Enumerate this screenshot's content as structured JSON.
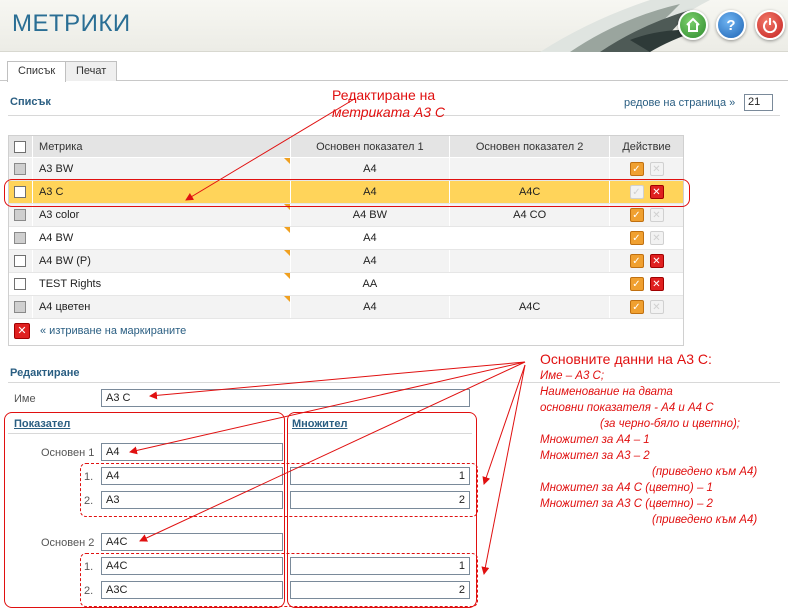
{
  "app": {
    "title": "МЕТРИКИ"
  },
  "header": {
    "help_label": "?"
  },
  "tabs": [
    {
      "label": "Списък"
    },
    {
      "label": "Печат"
    }
  ],
  "list": {
    "heading": "Списък",
    "rows_per_page_label": "редове на страница »",
    "rows_per_page_value": "21",
    "columns": [
      "Метрика",
      "Основен показател 1",
      "Основен показател 2",
      "Действие"
    ],
    "rows": [
      {
        "name": "A3 BW",
        "v1": "A4",
        "v2": ""
      },
      {
        "name": "A3 C",
        "v1": "A4",
        "v2": "A4C"
      },
      {
        "name": "A3 color",
        "v1": "A4 BW",
        "v2": "A4 CO"
      },
      {
        "name": "A4 BW",
        "v1": "A4",
        "v2": ""
      },
      {
        "name": "A4 BW (P)",
        "v1": "A4",
        "v2": ""
      },
      {
        "name": "TEST Rights",
        "v1": "AA",
        "v2": ""
      },
      {
        "name": "A4 цветен",
        "v1": "A4",
        "v2": "A4C"
      }
    ],
    "delete_marked": "« изтриване на маркираните"
  },
  "edit": {
    "heading": "Редактиране",
    "name_label": "Име",
    "name_value": "A3 C",
    "indicator_heading": "Показател",
    "multiplier_heading": "Множител",
    "main1_label": "Основен 1",
    "main1_value": "A4",
    "main2_label": "Основен 2",
    "main2_value": "A4C",
    "n1": "1.",
    "n2": "2.",
    "group1": [
      {
        "value": "A4",
        "mult": "1"
      },
      {
        "value": "A3",
        "mult": "2"
      }
    ],
    "group2": [
      {
        "value": "A4C",
        "mult": "1"
      },
      {
        "value": "A3C",
        "mult": "2"
      }
    ]
  },
  "annotations": {
    "edit_callout_line1": "Редактиране на",
    "edit_callout_line2": "метриката А3 С",
    "data_callout_title": "Основните данни на А3 С:",
    "data_callout_lines": [
      "Име – А3 С;",
      "Наименование на двата",
      "основни показателя - А4 и А4 С",
      "(за черно-бяло и цветно);",
      "Множител за А4 – 1",
      "Множител за А3 – 2",
      "(приведено към А4)",
      "Множител за А4 С (цветно) – 1",
      "Множител за А3 С (цветно) – 2",
      "(приведено към А4)"
    ]
  }
}
